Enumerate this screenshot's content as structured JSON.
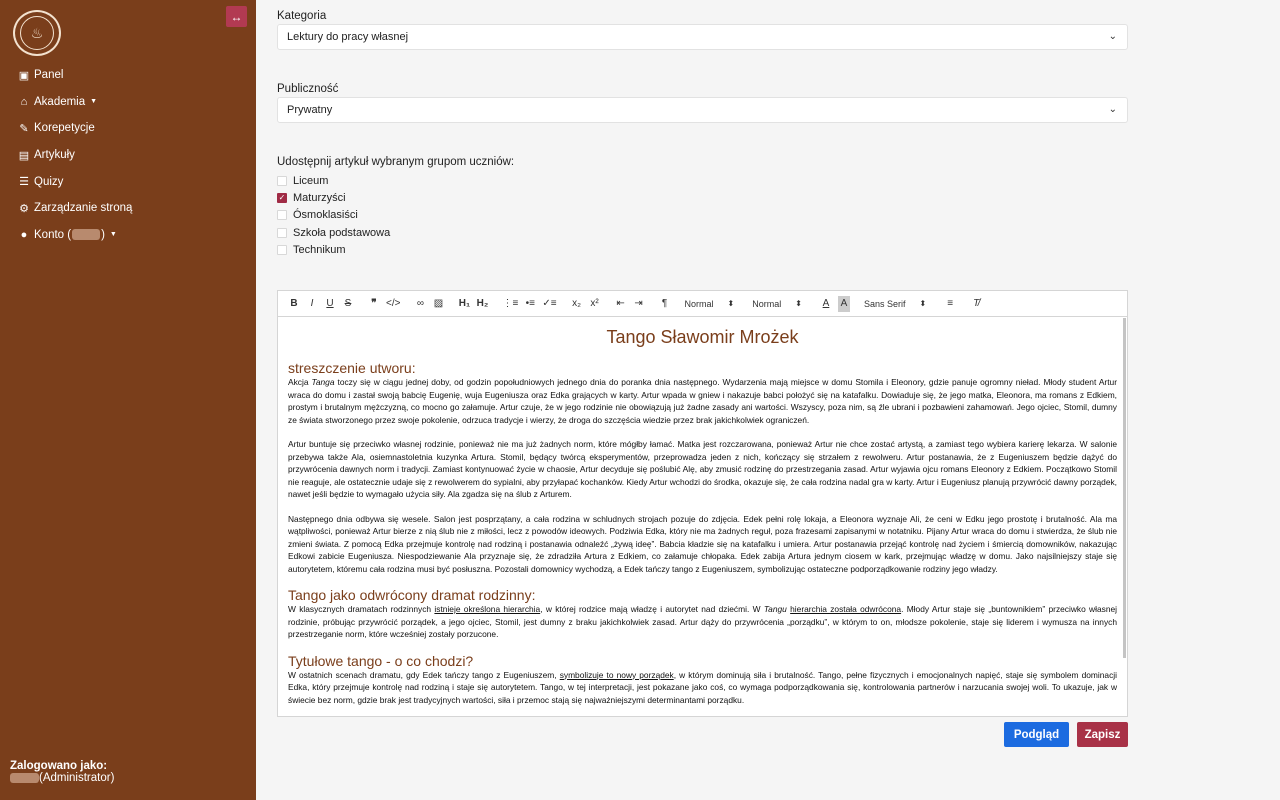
{
  "sidebar": {
    "logo_text": "AKADEMIA WIEDZY · EDYTA POLAK",
    "toggle_label": "↔",
    "items": [
      {
        "label": "Panel",
        "icon": "panel-icon",
        "has_caret": false
      },
      {
        "label": "Akademia",
        "icon": "academy-icon",
        "has_caret": true
      },
      {
        "label": "Korepetycje",
        "icon": "tutoring-icon",
        "has_caret": false
      },
      {
        "label": "Artykuły",
        "icon": "articles-icon",
        "has_caret": false
      },
      {
        "label": "Quizy",
        "icon": "quiz-icon",
        "has_caret": false
      },
      {
        "label": "Zarządzanie stroną",
        "icon": "gears-icon",
        "has_caret": false
      },
      {
        "label": "Konto (",
        "suffix": ")",
        "icon": "user-icon",
        "has_caret": true
      }
    ],
    "logged_label": "Zalogowano jako:",
    "logged_role": "(Administrator)"
  },
  "form": {
    "category_label": "Kategoria",
    "category_value": "Lektury do pracy własnej",
    "audience_label": "Publiczność",
    "audience_value": "Prywatny",
    "groups_title": "Udostępnij artykuł wybranym grupom uczniów:",
    "groups": [
      {
        "label": "Liceum",
        "checked": false
      },
      {
        "label": "Maturzyści",
        "checked": true
      },
      {
        "label": "Ósmoklasiści",
        "checked": false
      },
      {
        "label": "Szkoła podstawowa",
        "checked": false
      },
      {
        "label": "Technikum",
        "checked": false
      }
    ]
  },
  "toolbar": {
    "size_select": "Normal",
    "header_select": "Normal",
    "font_select": "Sans Serif"
  },
  "article": {
    "title": "Tango Sławomir Mrożek",
    "s1_heading": "streszczenie utworu:",
    "s1_p1_a": "Akcja ",
    "s1_p1_em": "Tanga",
    "s1_p1_b": " toczy się w ciągu jednej doby, od godzin popołudniowych jednego dnia do poranka dnia następnego. Wydarzenia mają miejsce w domu Stomila i Eleonory, gdzie panuje ogromny nieład. Młody student Artur wraca do domu i zastał swoją babcię Eugenię, wuja Eugeniusza oraz Edka grających w karty. Artur wpada w gniew i nakazuje babci położyć się na katafalku. Dowiaduje się, że jego matka, Eleonora, ma romans z Edkiem, prostym i brutalnym mężczyzną, co mocno go załamuje. Artur czuje, że w jego rodzinie nie obowiązują już żadne zasady ani wartości. Wszyscy, poza nim, są źle ubrani i pozbawieni zahamowań. Jego ojciec, Stomil, dumny ze świata stworzonego przez swoje pokolenie, odrzuca tradycje i wierzy, że droga do szczęścia wiedzie przez brak jakichkolwiek ograniczeń.",
    "s1_p2": "Artur buntuje się przeciwko własnej rodzinie, ponieważ nie ma już żadnych norm, które mógłby łamać. Matka jest rozczarowana, ponieważ Artur nie chce zostać artystą, a zamiast tego wybiera karierę lekarza. W salonie przebywa także Ala, osiemnastoletnia kuzynka Artura. Stomil, będący twórcą eksperymentów, przeprowadza jeden z nich, kończący się strzałem z rewolweru. Artur postanawia, że z Eugeniuszem będzie dążyć do przywrócenia dawnych norm i tradycji. Zamiast kontynuować życie w chaosie, Artur decyduje się poślubić Alę, aby zmusić rodzinę do przestrzegania zasad. Artur wyjawia ojcu romans Eleonory z Edkiem. Początkowo Stomil nie reaguje, ale ostatecznie udaje się z rewolwerem do sypialni, aby przyłapać kochanków. Kiedy Artur wchodzi do środka, okazuje się, że cała rodzina nadal gra w karty. Artur i Eugeniusz planują przywrócić dawny porządek, nawet jeśli będzie to wymagało użycia siły. Ala zgadza się na ślub z Arturem.",
    "s1_p3": "Następnego dnia odbywa się wesele. Salon jest posprzątany, a cała rodzina w schludnych strojach pozuje do zdjęcia. Edek pełni rolę lokaja, a Eleonora wyznaje Ali, że ceni w Edku jego prostotę i brutalność. Ala ma wątpliwości, ponieważ Artur bierze z nią ślub nie z miłości, lecz z powodów ideowych. Podziwia Edka, który nie ma żadnych reguł, poza frazesami zapisanymi w notatniku. Pijany Artur wraca do domu i stwierdza, że ślub nie zmieni świata. Z pomocą Edka przejmuje kontrolę nad rodziną i postanawia odnaleźć „żywą ideę”. Babcia kładzie się na katafalku i umiera. Artur postanawia przejąć kontrolę nad życiem i śmiercią domowników, nakazując Edkowi zabicie Eugeniusza. Niespodziewanie Ala przyznaje się, że zdradziła Artura z Edkiem, co załamuje chłopaka. Edek zabija Artura jednym ciosem w kark, przejmując władzę w domu. Jako najsilniejszy staje się autorytetem, któremu cała rodzina musi być posłuszna. Pozostali domownicy wychodzą, a Edek tańczy tango z Eugeniuszem, symbolizując ostateczne podporządkowanie rodziny jego władzy.",
    "s2_heading": "Tango jako odwrócony dramat rodzinny:",
    "s2_a": "W klasycznych dramatach rodzinnych ",
    "s2_u1": "istnieje określona hierarchia",
    "s2_b": ", w której rodzice mają władzę i autorytet nad dziećmi. W ",
    "s2_em": "Tangu",
    "s2_c": " ",
    "s2_u2": "hierarchia została odwrócona",
    "s2_d": ". Młody Artur staje się „buntownikiem” przeciwko własnej rodzinie, próbując przywrócić porządek, a jego ojciec, Stomil, jest dumny z braku jakichkolwiek zasad. Artur dąży do przywrócenia „porządku”, w którym to on, młodsze pokolenie, staje się liderem i wymusza na innych przestrzeganie norm, które wcześniej zostały porzucone.",
    "s3_heading": "Tytułowe tango - o co chodzi?",
    "s3_a": "W ostatnich scenach dramatu, gdy Edek tańczy tango z Eugeniuszem, ",
    "s3_u1": "symbolizuje to nowy porządek",
    "s3_b": ", w którym dominują siła i brutalność. Tango, pełne fizycznych i emocjonalnych napięć, staje się symbolem dominacji Edka, który przejmuje kontrolę nad rodziną i staje się autorytetem. Tango, w tej interpretacji, jest pokazane jako coś, co wymaga podporządkowania się, kontrolowania partnerów i narzucania swojej woli. To ukazuje, jak w świecie bez norm, gdzie brak jest tradycyjnych wartości, siła i przemoc stają się najważniejszymi determinantami porządku."
  },
  "buttons": {
    "preview": "Podgląd",
    "save": "Zapisz"
  },
  "colors": {
    "sidebar": "#7a3e1b",
    "preview": "#1c6be0",
    "save": "#a83247",
    "checkbox": "#a02b45"
  }
}
